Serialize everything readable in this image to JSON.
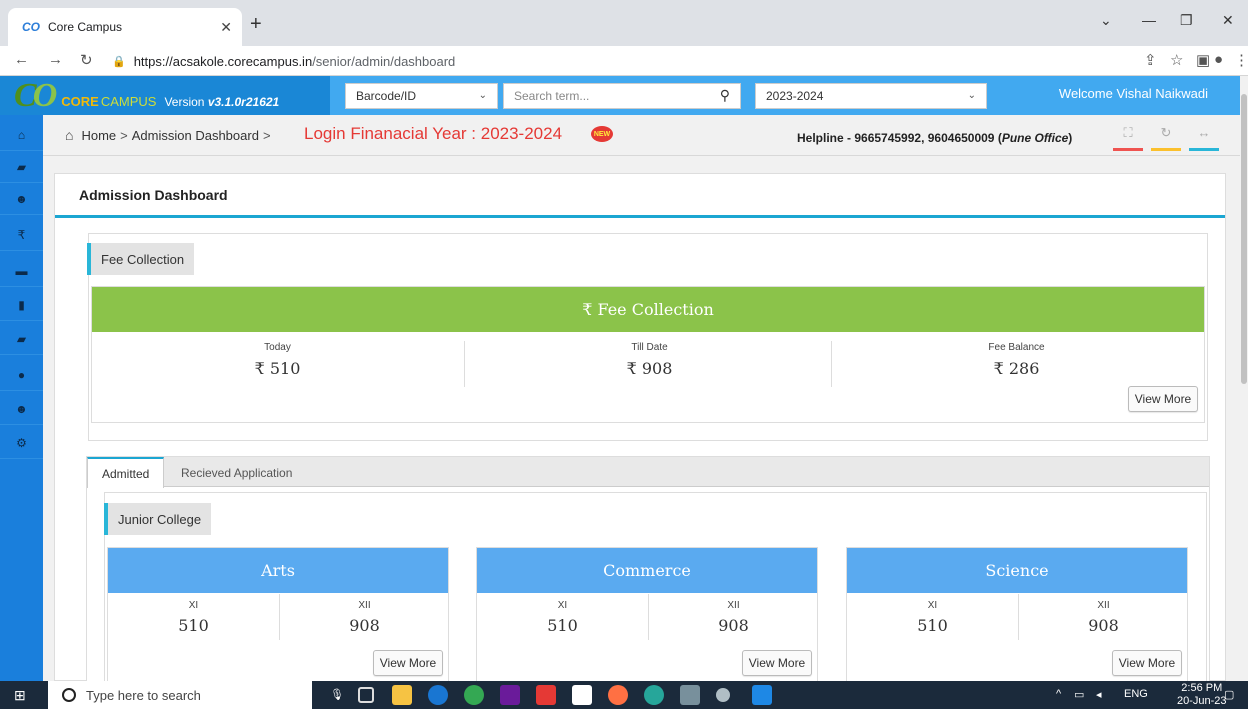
{
  "browser": {
    "tab_title": "Core Campus",
    "url_host": "https://acsakole.corecampus.in",
    "url_path": "/senior/admin/dashboard"
  },
  "header": {
    "logo_co": "C",
    "logo_o": "O",
    "logo_core": "CORE",
    "logo_campus": "CAMPUS",
    "version_label": "Version",
    "version_value": "v3.1.0r21621",
    "barcode_select": "Barcode/ID",
    "search_placeholder": "Search term...",
    "year_select": "2023-2024",
    "welcome": "Welcome Vishal Naikwadi"
  },
  "breadcrumb": {
    "home": "Home",
    "current": "Admission Dashboard",
    "sep": ">"
  },
  "login_fy": "Login Finanacial Year : 2023-2024",
  "new_badge": "NEW",
  "helpline_prefix": "Helpline - 9665745992, 9604650009 (",
  "helpline_office": "Pune Office",
  "helpline_suffix": ")",
  "dashboard": {
    "title": "Admission Dashboard",
    "fee_tab_label": "Fee Collection",
    "fee_header": "₹ Fee Collection",
    "fee_stats": [
      {
        "caption": "Today",
        "value": "₹ 510"
      },
      {
        "caption": "Till Date",
        "value": "₹ 908"
      },
      {
        "caption": "Fee Balance",
        "value": "₹ 286"
      }
    ],
    "view_more": "View More",
    "tabs": [
      "Admitted",
      "Recieved Application"
    ],
    "junior_label": "Junior College",
    "streams": [
      {
        "name": "Arts",
        "cols": [
          {
            "caption": "XI",
            "value": "510"
          },
          {
            "caption": "XII",
            "value": "908"
          }
        ]
      },
      {
        "name": "Commerce",
        "cols": [
          {
            "caption": "XI",
            "value": "510"
          },
          {
            "caption": "XII",
            "value": "908"
          }
        ]
      },
      {
        "name": "Science",
        "cols": [
          {
            "caption": "XI",
            "value": "510"
          },
          {
            "caption": "XII",
            "value": "908"
          }
        ]
      }
    ]
  },
  "taskbar": {
    "search_placeholder": "Type here to search",
    "lang": "ENG",
    "time": "2:56 PM",
    "date": "20-Jun-23"
  },
  "colors": {
    "sidebar": "#1a7fdc",
    "header": "#41a9f0",
    "fee_header": "#8bc34a",
    "stream_header": "#5aaaf0",
    "accent": "#1ba6d2"
  },
  "icons": {
    "sidebar": [
      "home-icon",
      "graduation-cap-icon",
      "users-icon",
      "rupee-icon",
      "book-icon",
      "file-icon",
      "graduation-cap-icon",
      "user-icon",
      "users-icon",
      "cogs-icon"
    ]
  }
}
